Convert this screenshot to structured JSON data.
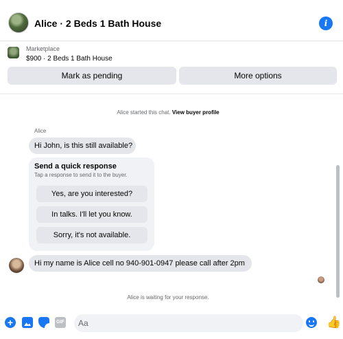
{
  "header": {
    "title": "Alice · 2 Beds 1 Bath House",
    "info_icon": "info-icon",
    "info_glyph": "i"
  },
  "listing": {
    "source": "Marketplace",
    "summary": "$900 · 2 Beds 1 Bath House"
  },
  "actions": {
    "pending_label": "Mark as pending",
    "more_label": "More options"
  },
  "chat": {
    "started_prefix": "Alice started this chat.",
    "view_profile": "View buyer profile",
    "sender_name": "Alice",
    "message_1": "Hi John, is this still available?",
    "quick_response": {
      "title": "Send a quick response",
      "subtitle": "Tap a response to send it to the buyer.",
      "options": [
        "Yes, are you interested?",
        "In talks. I'll let you know.",
        "Sorry, it's not available."
      ]
    },
    "message_2": "Hi my name is Alice cell no 940-901-0947 please call after 2pm",
    "waiting_text": "Alice is waiting for your response."
  },
  "composer": {
    "placeholder": "Aa",
    "gif_label": "GIF",
    "plus_glyph": "+",
    "like_glyph": "👍"
  },
  "colors": {
    "accent": "#1877f2",
    "bubble": "#e4e6eb",
    "secondary_text": "#65676b"
  }
}
